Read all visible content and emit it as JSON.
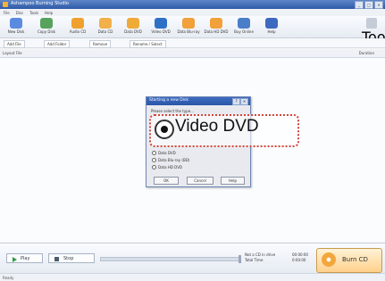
{
  "window": {
    "title": "Ashampoo Burning Studio"
  },
  "menubar": {
    "items": [
      "File",
      "Disc",
      "Tools",
      "Help"
    ]
  },
  "toolbar": {
    "items": [
      {
        "label": "New Disk",
        "icon": "new-disk-icon",
        "color": "#5b8be0"
      },
      {
        "label": "Copy Disk",
        "icon": "copy-disk-icon",
        "color": "#57a35d"
      },
      {
        "label": "Audio CD",
        "icon": "audio-cd-icon",
        "color": "#f0a02e"
      },
      {
        "label": "Data CD",
        "icon": "data-cd-icon",
        "color": "#f2b04a"
      },
      {
        "label": "Data DVD",
        "icon": "data-dvd-icon",
        "color": "#f0aa38"
      },
      {
        "label": "Video DVD",
        "icon": "video-dvd-icon",
        "color": "#2f70c7"
      },
      {
        "label": "Data Blu-ray",
        "icon": "data-bluray-icon",
        "color": "#f1a03a"
      },
      {
        "label": "Data HD DVD",
        "icon": "data-hd-dvd-icon",
        "color": "#f1a03a"
      },
      {
        "label": "Buy Online",
        "icon": "buy-online-icon",
        "color": "#4b7ec9"
      },
      {
        "label": "Help",
        "icon": "help-icon",
        "color": "#3d6ac0"
      }
    ],
    "toolbox_label": "Toolbox"
  },
  "subbar": {
    "items": [
      "Add File",
      "Add Folder",
      "Remove",
      "Rename / Select"
    ]
  },
  "columns": {
    "left": "Layout File",
    "right": "Duration"
  },
  "dialog": {
    "title": "Starting a new Disk",
    "prompt": "Please select the type...",
    "options": [
      "Data DVD",
      "Data Blu-ray (BD)",
      "Data HD DVD"
    ],
    "buttons": [
      "OK",
      "Cancel",
      "Help"
    ]
  },
  "callout": {
    "label": "Video DVD",
    "selected": true
  },
  "status": {
    "play": "Play",
    "stop": "Stop",
    "labels": [
      "Not a CD in drive",
      "Total Time"
    ],
    "values": [
      "00:00:00",
      "0:00:00"
    ]
  },
  "burn": {
    "label": "Burn CD"
  },
  "footer": {
    "text": "Ready"
  }
}
